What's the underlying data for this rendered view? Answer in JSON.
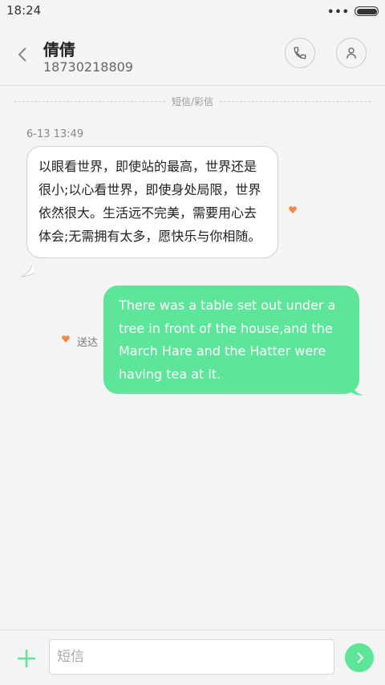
{
  "status_bar": {
    "time": "18:24",
    "dots": "•••"
  },
  "header": {
    "contact_name": "倩倩",
    "contact_number": "18730218809",
    "icons": {
      "back": "chevron-left-icon",
      "call": "phone-icon",
      "profile": "person-icon"
    }
  },
  "conversation": {
    "divider_label": "短信/彩信",
    "messages": [
      {
        "direction": "incoming",
        "time": "6-13 13:49",
        "text": "以眼看世界，即使站的最高，世界还是很小;以心看世界，即使身处局限，世界依然很大。生活远不完美，需要用心去体会;无需拥有太多，愿快乐与你相随。"
      },
      {
        "direction": "outgoing",
        "text": "There was a table set out under a tree in front of the house,and the March Hare and the Hatter were having tea at it.",
        "status": "送达"
      }
    ]
  },
  "composer": {
    "placeholder": "短信",
    "value": ""
  },
  "colors": {
    "accent_green": "#5de59a",
    "heart_orange": "#f08a4b",
    "background": "#f4f4f4"
  }
}
